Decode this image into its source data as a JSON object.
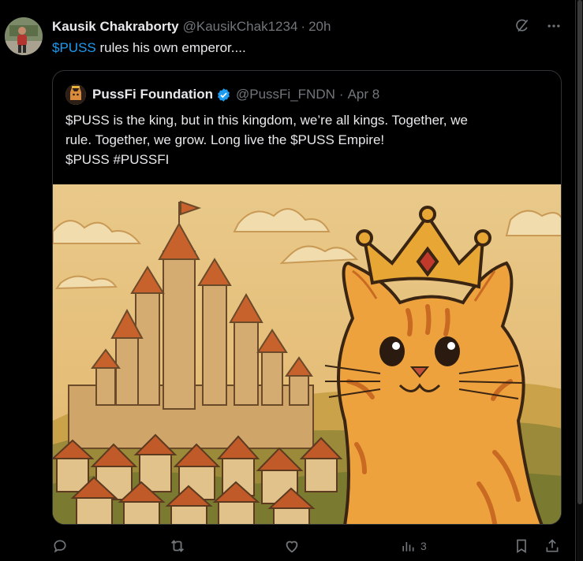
{
  "tweet": {
    "author_name": "Kausik Chakraborty",
    "author_handle": "@KausikChak1234",
    "separator": "·",
    "time": "20h",
    "cashtag": "$PUSS",
    "text_rest": " rules his own emperor....",
    "icons": [
      "grok-icon",
      "more-icon"
    ]
  },
  "quote": {
    "author_name": "PussFi Foundation",
    "author_handle": "@PussFi_FNDN",
    "separator": "·",
    "date": "Apr 8",
    "verified": true,
    "lines": [
      "$PUSS is the king, but in this kingdom,  we’re all kings. Together, we",
      "rule. Together, we grow. Long live the $PUSS Empire!",
      "$PUSS #PUSSFI"
    ],
    "image_description_icon": "cat-king-illustration"
  },
  "actions": {
    "reply_count": "",
    "retweet_count": "",
    "like_count": "",
    "views_count": "3"
  },
  "colors": {
    "background": "#000000",
    "text": "#e7e9ea",
    "muted": "#71767b",
    "accent": "#1d9bf0",
    "border": "#2f3336"
  }
}
